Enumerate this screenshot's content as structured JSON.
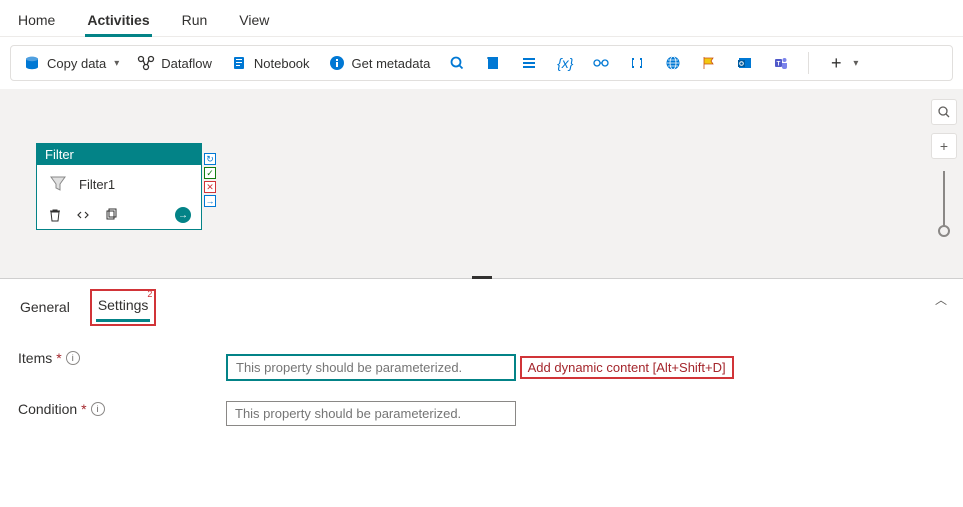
{
  "menu": {
    "tabs": [
      "Home",
      "Activities",
      "Run",
      "View"
    ],
    "active": "Activities"
  },
  "toolbar": {
    "copy_data": "Copy data",
    "dataflow": "Dataflow",
    "notebook": "Notebook",
    "get_metadata": "Get metadata"
  },
  "node": {
    "type": "Filter",
    "name": "Filter1"
  },
  "panel": {
    "tabs": {
      "general": "General",
      "settings": "Settings"
    },
    "badge": "2",
    "items_label": "Items",
    "condition_label": "Condition",
    "items_placeholder": "This property should be parameterized.",
    "condition_placeholder": "This property should be parameterized.",
    "dynamic_link": "Add dynamic content [Alt+Shift+D]"
  },
  "icons": {
    "variable": "{x}"
  }
}
